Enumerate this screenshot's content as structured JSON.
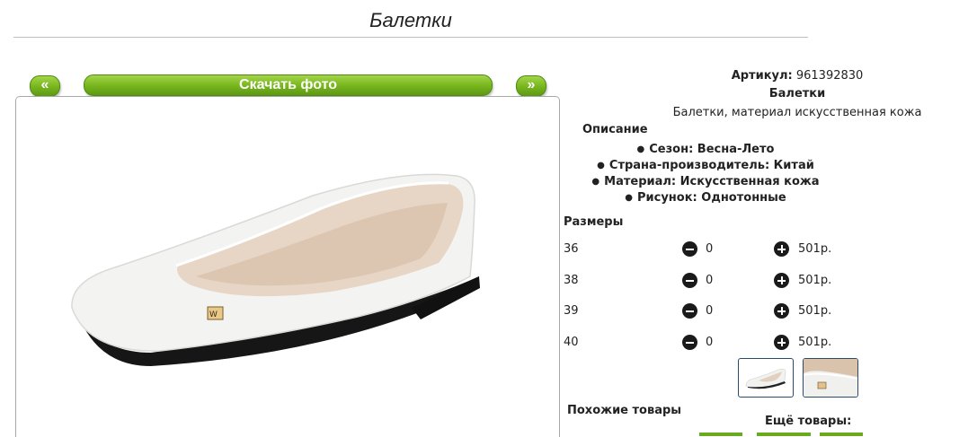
{
  "page": {
    "title": "Балетки"
  },
  "gallery": {
    "prev_label": "«",
    "next_label": "»",
    "download_label": "Скачать фото"
  },
  "product": {
    "article_label": "Артикул:",
    "article_value": "961392830",
    "name": "Балетки",
    "subtitle": "Балетки, материал искусственная кожа",
    "description_heading": "Описание",
    "features": [
      "Сезон: Весна-Лето",
      "Страна-производитель: Китай",
      "Материал: Искусственная кожа",
      "Рисунок: Однотонные"
    ],
    "sizes_heading": "Размеры",
    "sizes": [
      {
        "size": "36",
        "qty": "0",
        "price": "501р."
      },
      {
        "size": "38",
        "qty": "0",
        "price": "501р."
      },
      {
        "size": "39",
        "qty": "0",
        "price": "501р."
      },
      {
        "size": "40",
        "qty": "0",
        "price": "501р."
      }
    ]
  },
  "related": {
    "similar_heading": "Похожие товары",
    "more_heading": "Ещё товары:"
  },
  "colors": {
    "button_green": "#79b71f",
    "thumb_border": "#2b4a6f"
  }
}
